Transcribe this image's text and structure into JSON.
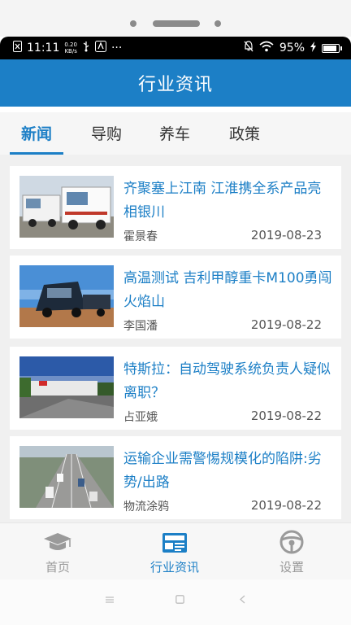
{
  "statusbar": {
    "time": "11:11",
    "net_speed_value": "0.20",
    "net_speed_unit": "KB/s",
    "more": "···",
    "battery": "95%",
    "battery_level": 0.95
  },
  "header": {
    "title": "行业资讯"
  },
  "tabs": [
    {
      "label": "新闻",
      "active": true
    },
    {
      "label": "导购",
      "active": false
    },
    {
      "label": "养车",
      "active": false
    },
    {
      "label": "政策",
      "active": false
    }
  ],
  "articles": [
    {
      "title": "齐聚塞上江南 江淮携全系产品亮相银川",
      "author": "霍景春",
      "date": "2019-08-23"
    },
    {
      "title": "高温测试 吉利甲醇重卡M100勇闯火焰山",
      "author": "李国潘",
      "date": "2019-08-22"
    },
    {
      "title": "特斯拉：自动驾驶系统负责人疑似离职？",
      "author": "占亚娥",
      "date": "2019-08-22"
    },
    {
      "title": "运输企业需警惕规模化的陷阱:劣势/出路",
      "author": "物流涂鸦",
      "date": "2019-08-22"
    }
  ],
  "bottom_nav": [
    {
      "label": "首页",
      "icon": "graduation-cap-icon",
      "active": false
    },
    {
      "label": "行业资讯",
      "icon": "newspaper-icon",
      "active": true
    },
    {
      "label": "设置",
      "icon": "steering-wheel-icon",
      "active": false
    }
  ],
  "colors": {
    "accent": "#1c7fc6",
    "inactive": "#999999"
  }
}
